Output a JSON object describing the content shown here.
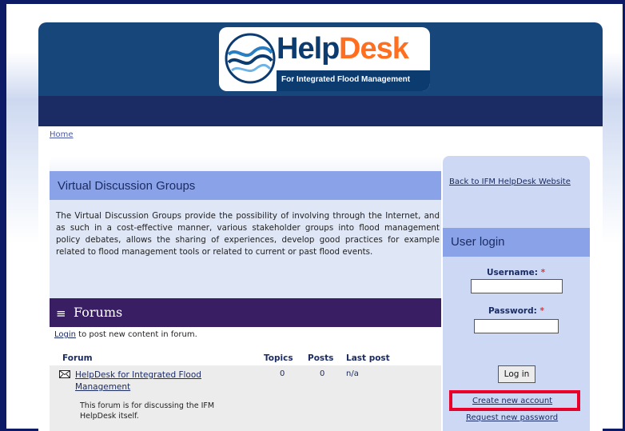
{
  "logo": {
    "word1": "Help",
    "word2": "Desk",
    "tagline": "For Integrated Flood Management"
  },
  "breadcrumb": {
    "home_label": "Home"
  },
  "vdg": {
    "title": "Virtual Discussion Groups",
    "description": "The Virtual Discussion Groups provide the possibility of involving through the Internet, and as such in a cost-effective manner, various stakeholder groups into flood management policy debates, allows the sharing of experiences, develop good practices for example related to flood management tools or related to current or past flood events."
  },
  "forums": {
    "title": "Forums",
    "icon": "menu-lines-icon",
    "login_link": "Login",
    "login_note_suffix": " to post new content in forum.",
    "columns": [
      "Forum",
      "Topics",
      "Posts",
      "Last post"
    ],
    "rows": [
      {
        "name": "HelpDesk for Integrated Flood Management",
        "topics": "0",
        "posts": "0",
        "last_post": "n/a",
        "description": "This forum is for discussing the IFM HelpDesk itself.",
        "icon": "envelope-icon"
      }
    ]
  },
  "sidebar": {
    "back_link": "Back to IFM HelpDesk Website",
    "user_login_title": "User login",
    "username_label": "Username:",
    "password_label": "Password:",
    "required_mark": "*",
    "username_value": "",
    "password_value": "",
    "login_button": "Log in",
    "create_account": "Create new account",
    "request_password": "Request new password"
  },
  "colors": {
    "header_blue": "#16467a",
    "nav_dark": "#1b2b63",
    "section_header": "#8aa3e8",
    "forums_header": "#3a1e63",
    "highlight_red": "#e8002a",
    "logo_orange": "#ff6f1f"
  }
}
